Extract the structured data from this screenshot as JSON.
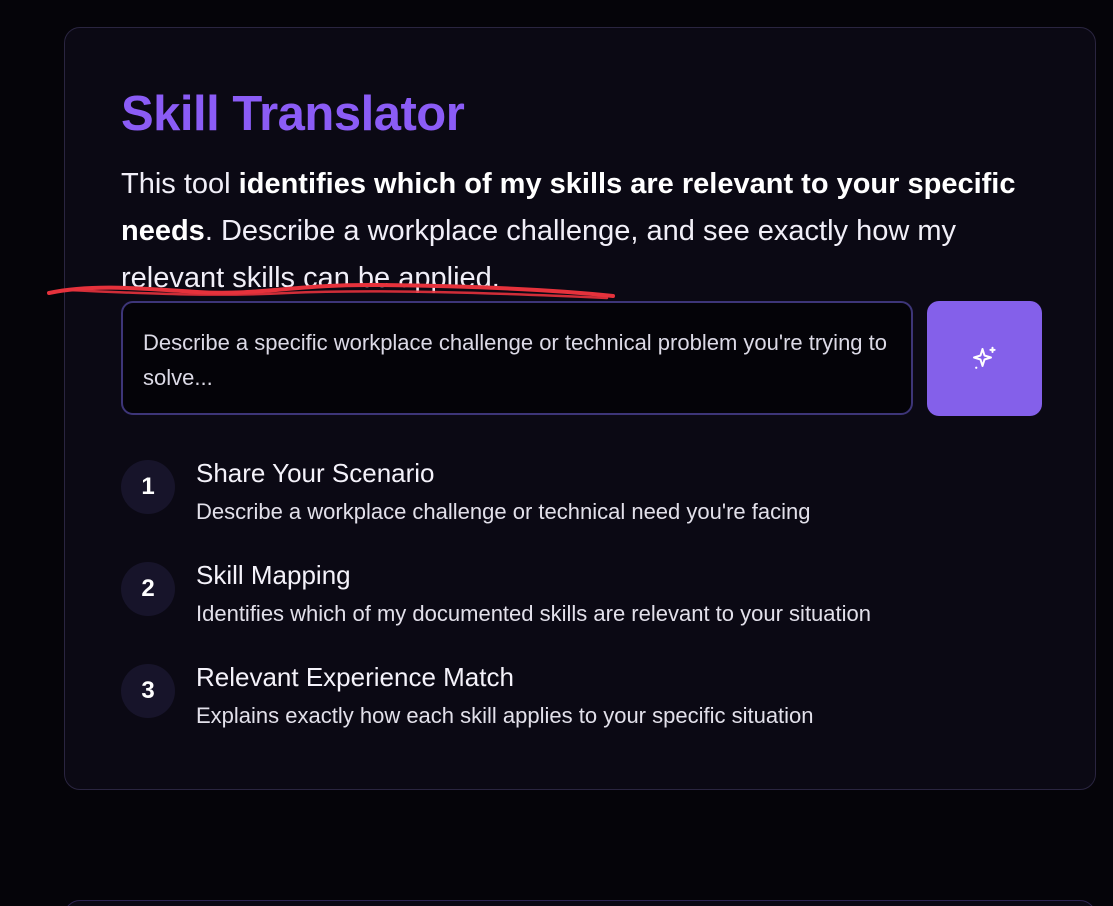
{
  "tool": {
    "title": "Skill Translator",
    "description": {
      "part1": "This tool ",
      "bold": "identifies which of my skills are relevant to your specific needs",
      "part2": ". Describe a workplace challenge, and see exactly how my relevant skills can be applied."
    }
  },
  "scenario_input": {
    "placeholder": "Describe a specific workplace challenge or technical problem you're trying to solve..."
  },
  "submit_button": {
    "icon": "sparkles-icon"
  },
  "steps": [
    {
      "number": "1",
      "title": "Share Your Scenario",
      "description": "Describe a workplace challenge or technical need you're facing"
    },
    {
      "number": "2",
      "title": "Skill Mapping",
      "description": "Identifies which of my documented skills are relevant to your situation"
    },
    {
      "number": "3",
      "title": "Relevant Experience Match",
      "description": "Explains exactly how each skill applies to your specific situation"
    }
  ],
  "colors": {
    "accent": "#8b5cf6",
    "button": "#8460ea",
    "background": "#050409",
    "card": "#0b0914",
    "annotation": "#e6323c"
  }
}
